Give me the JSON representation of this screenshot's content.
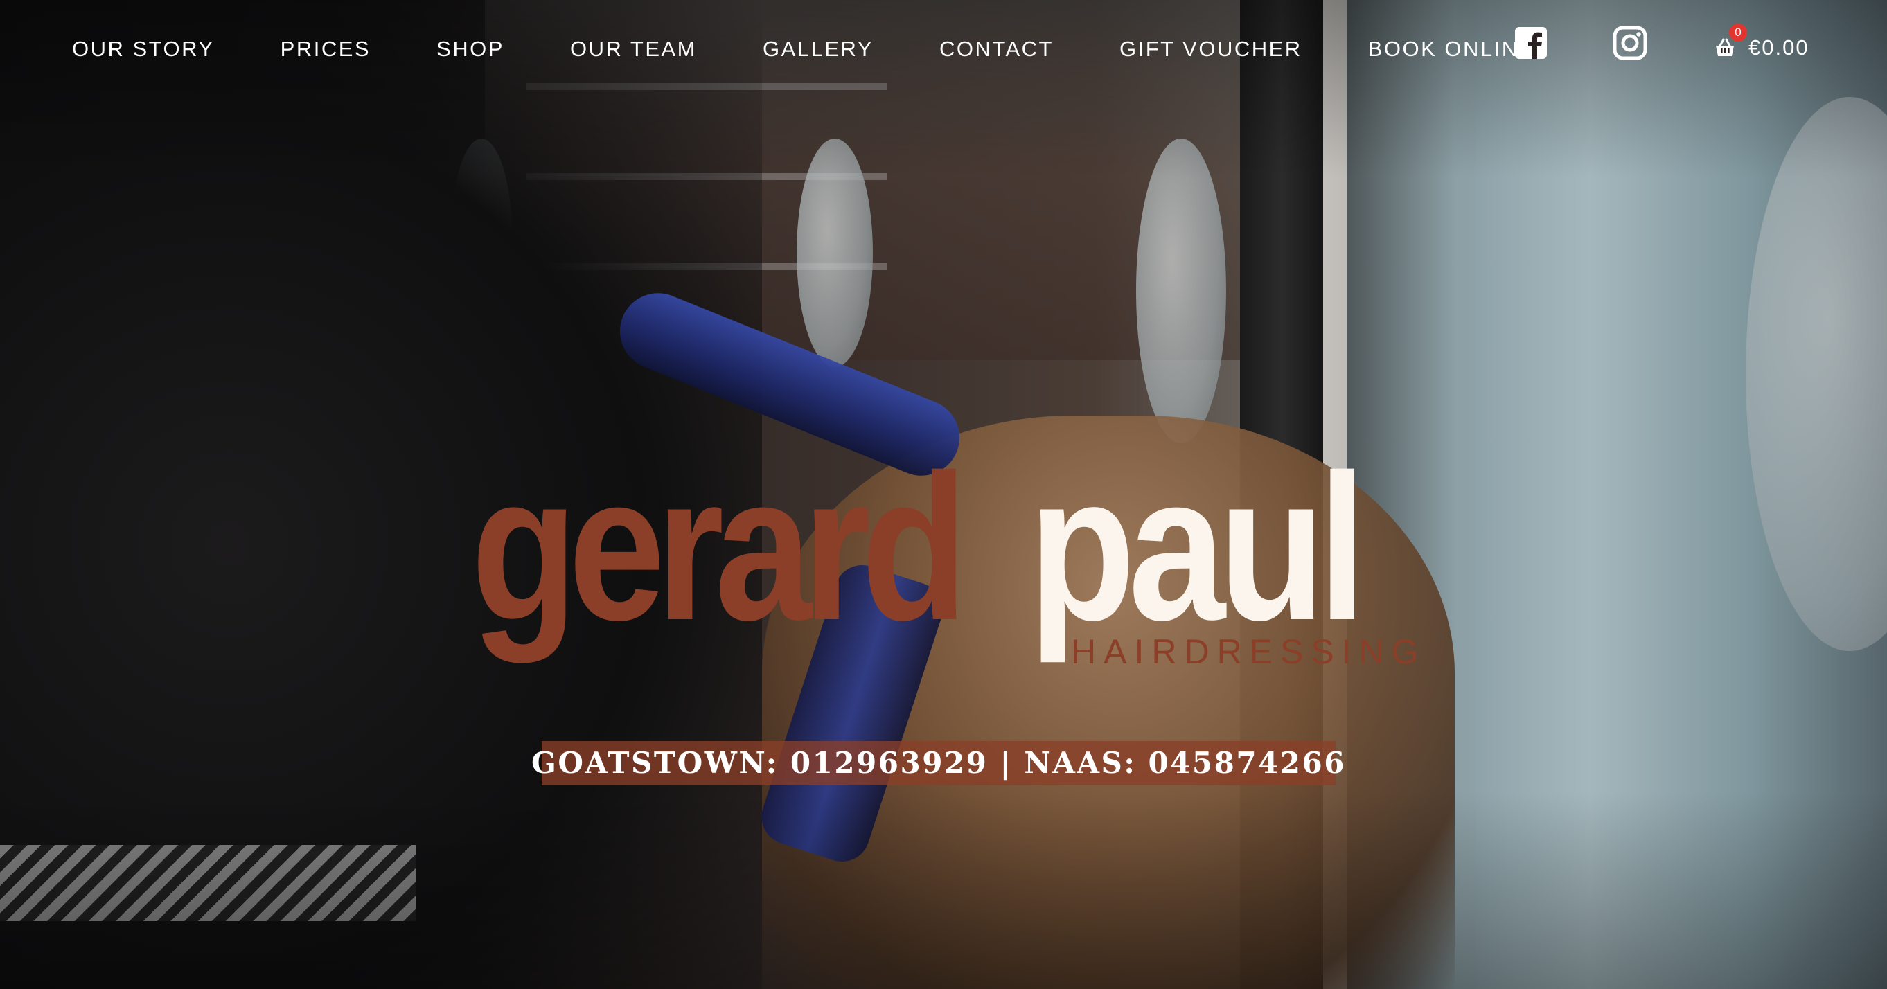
{
  "nav": {
    "items": [
      {
        "label": "OUR STORY"
      },
      {
        "label": "PRICES"
      },
      {
        "label": "SHOP"
      },
      {
        "label": "OUR TEAM"
      },
      {
        "label": "GALLERY"
      },
      {
        "label": "CONTACT"
      },
      {
        "label": "GIFT VOUCHER"
      },
      {
        "label": "BOOK ONLINE"
      }
    ],
    "social": [
      {
        "icon": "facebook-icon"
      },
      {
        "icon": "instagram-icon"
      }
    ],
    "cart": {
      "icon": "basket-icon",
      "count": "0",
      "total": "€0.00"
    }
  },
  "hero": {
    "logo": {
      "part1": "gerard",
      "part2": "paul",
      "subtitle": "HAIRDRESSING"
    },
    "phones": "GOATSTOWN: 012963929 | NAAS: 045874266",
    "background_image": "hairdresser blow-drying client's hair in salon"
  },
  "colors": {
    "brand": "#8b3f28",
    "logo_light": "#fbf5ee",
    "badge": "#e3352f",
    "nav_text": "#ffffff"
  }
}
